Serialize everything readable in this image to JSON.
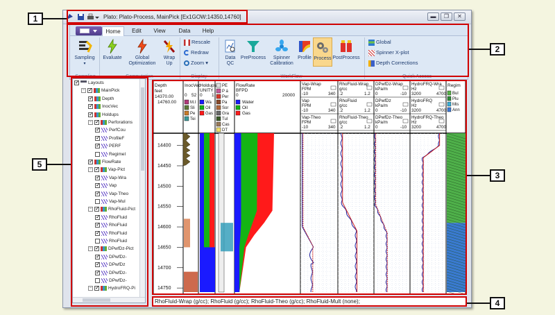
{
  "window": {
    "title": "Plato: Plato-Process, MainPick [Ex1GOW:14350,14760]",
    "controls": {
      "minimize": "▬",
      "restore": "❐",
      "close": "✕"
    }
  },
  "ribbon": {
    "tabs": [
      {
        "label": "Home",
        "active": true
      },
      {
        "label": "Edit"
      },
      {
        "label": "View"
      },
      {
        "label": "Data"
      },
      {
        "label": "Help"
      }
    ],
    "buttons": {
      "sampling": "Sampling",
      "evaluate": "Evaluate",
      "global_opt": "Global\nOptimization",
      "wrap_up": "Wrap\nUp",
      "rescale": "Rescale",
      "redraw": "Redraw",
      "zoom": "Zoom",
      "data_qc": "Data\nQC",
      "preprocess": "PreProcess",
      "spinner_cal": "Spinner\nCalibration",
      "profile": "Profile",
      "process": "Process",
      "postprocess": "PostProcess",
      "global": "Global",
      "spinner_xplot": "Spinner X-plot",
      "depth_corrections": "Depth Corrections"
    },
    "groups": {
      "sampling": "Sampling",
      "computation": "Computation",
      "display": "Display",
      "workflow": "WorkFlow",
      "quick_access": "Quick Access"
    }
  },
  "tree": {
    "items": [
      {
        "label": "Layouts",
        "level": 0,
        "checked": true
      },
      {
        "label": "MainPick",
        "level": 1,
        "checked": true
      },
      {
        "label": "Depth",
        "level": 2,
        "checked": true
      },
      {
        "label": "InocVec",
        "level": 2,
        "checked": true
      },
      {
        "label": "Holdups",
        "level": 2,
        "checked": true
      },
      {
        "label": "Perforations",
        "level": 2,
        "checked": true
      },
      {
        "label": "PerfCou",
        "level": 3,
        "checked": true
      },
      {
        "label": "ProfileF",
        "level": 3,
        "checked": true
      },
      {
        "label": "PERF",
        "level": 3,
        "checked": true
      },
      {
        "label": "RegimeI",
        "level": 3,
        "checked": false
      },
      {
        "label": "FlowRate",
        "level": 2,
        "checked": true
      },
      {
        "label": "Vap-Pict",
        "level": 2,
        "checked": true
      },
      {
        "label": "Vap-Wra",
        "level": 3,
        "checked": true
      },
      {
        "label": "Vap",
        "level": 3,
        "checked": true
      },
      {
        "label": "Vap-Theo",
        "level": 3,
        "checked": true
      },
      {
        "label": "Vap-Mul",
        "level": 3,
        "checked": false
      },
      {
        "label": "RhoFluid-Pict",
        "level": 2,
        "checked": true
      },
      {
        "label": "RhoFluid",
        "level": 3,
        "checked": true
      },
      {
        "label": "RhoFluid",
        "level": 3,
        "checked": true
      },
      {
        "label": "RhoFluid",
        "level": 3,
        "checked": true
      },
      {
        "label": "RhoFluid",
        "level": 3,
        "checked": false
      },
      {
        "label": "DPwfDz-Pict",
        "level": 2,
        "checked": true
      },
      {
        "label": "DPwfDz-",
        "level": 3,
        "checked": true
      },
      {
        "label": "DPwfDz",
        "level": 3,
        "checked": true
      },
      {
        "label": "DPwfDz-",
        "level": 3,
        "checked": true
      },
      {
        "label": "DPwfDz-",
        "level": 3,
        "checked": false
      },
      {
        "label": "HydroFRQ-Pi",
        "level": 2,
        "checked": true
      }
    ]
  },
  "plot": {
    "depth": {
      "title": "Depth",
      "unit": "feet",
      "top": "14370.00",
      "bottom": "14760.00",
      "ticks": [
        "14400",
        "14450",
        "14500",
        "14550",
        "14600",
        "14650",
        "14700",
        "14750"
      ]
    },
    "inocvec": {
      "title": "InocVec",
      "min": "0",
      "max": "52",
      "legend": [
        "M.I",
        "Sli",
        "Pe",
        "Tei"
      ]
    },
    "holdups": {
      "title": "Holdups",
      "unit": "UNITY",
      "min": "0",
      "max": "1",
      "legend": [
        "Wa",
        "Oil",
        "Gas"
      ]
    },
    "perf": {
      "legend": [
        "PE",
        "P á",
        "Per",
        "Pa",
        "Sor",
        "Gra",
        "Tul",
        "Cas",
        "DT"
      ]
    },
    "flowrate": {
      "title": "FlowRate",
      "unit": "BFPD",
      "min": "0",
      "max": "20000",
      "legend": [
        "Water",
        "Oil",
        "Gas"
      ]
    },
    "vap": {
      "h1": "Vap-Wrap",
      "h1u": "FPM",
      "h1a": "-10",
      "h1b": "340",
      "h2": "Vap",
      "h2u": "FPM",
      "h2a": "-10",
      "h2b": "340",
      "h3": "Vap-Theo",
      "h3u": "FPM",
      "h3a": "-10",
      "h3b": "340"
    },
    "rho": {
      "h1": "RhoFluid-Wrap",
      "h1u": "g/cc",
      "h1a": ".2",
      "h1b": "1.2",
      "h2": "RhoFluid",
      "h2u": "g/cc",
      "h2a": ".2",
      "h2b": "1.2",
      "h3": "RhoFluid-Theo",
      "h3u": "g/cc",
      "h3a": ".2",
      "h3b": "1.2"
    },
    "dp": {
      "h1": "DPwfDz-Wrap",
      "h1u": "kPa/m",
      "h1a": "0",
      "h1b": "-10",
      "h2": "DPwfDz",
      "h2u": "kPa/m",
      "h2a": "0",
      "h2b": "-10",
      "h3": "DPwfDz-Theo",
      "h3u": "kPa/m",
      "h3a": "0",
      "h3b": "-10"
    },
    "hydro": {
      "h1": "HydroFRQ-Wra",
      "h1u": "Hz",
      "h1a": "3200",
      "h1b": "4700",
      "h2": "HydroFRQ",
      "h2u": "Hz",
      "h2a": "3200",
      "h2b": "4700",
      "h3": "HydroFRQ-Theo",
      "h3u": "Hz",
      "h3a": "3200",
      "h3b": "4700"
    },
    "regime": {
      "title": "Regim",
      "legend": [
        "Bul",
        "Plu",
        "Mis",
        "Ann"
      ]
    }
  },
  "status_text": "RhoFluid-Wrap (g/cc); RhoFluid (g/cc); RhoFluid-Theo (g/cc); RhoFluid-Mult (none);",
  "callouts": [
    "1",
    "2",
    "3",
    "4",
    "5"
  ],
  "colors": {
    "water": "#1a1aff",
    "oil": "#14b414",
    "gas": "#ff1a1a",
    "callout": "#d00000"
  }
}
